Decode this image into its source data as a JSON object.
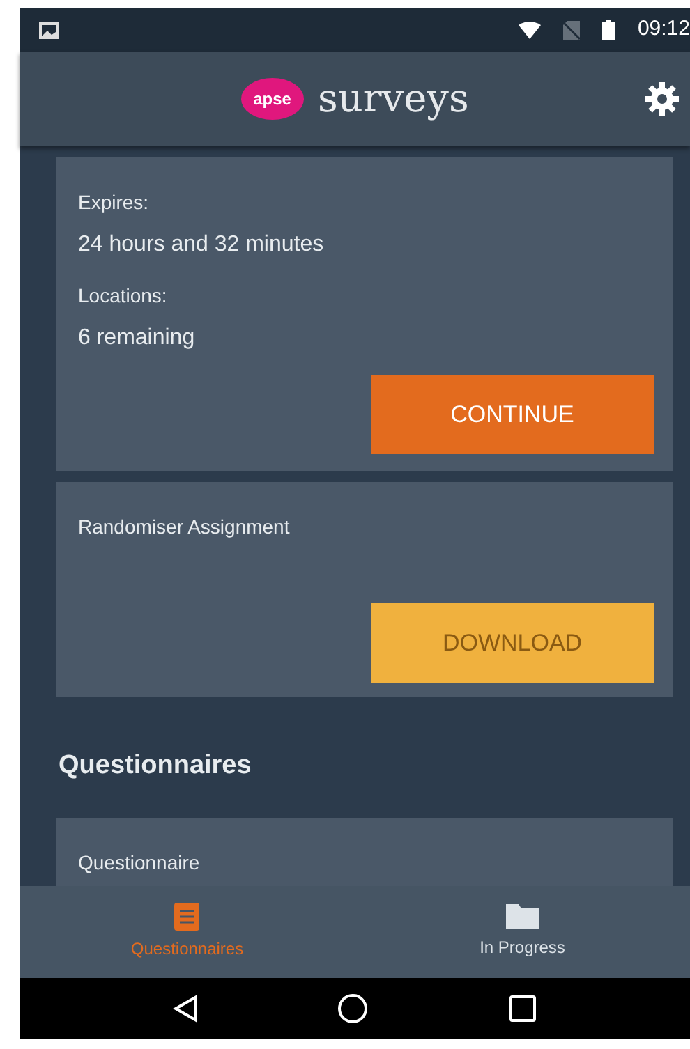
{
  "status_bar": {
    "time": "09:12"
  },
  "app_bar": {
    "logo_badge": "apse",
    "title": "surveys"
  },
  "assignment_card": {
    "fields": [
      {
        "label": "Expires:",
        "value": "24 hours and 32 minutes"
      },
      {
        "label": "Locations:",
        "value": "6 remaining"
      }
    ],
    "button": {
      "label": "CONTINUE",
      "disabled": false
    }
  },
  "randomiser_card": {
    "title": "Randomiser Assignment",
    "button": {
      "label": "DOWNLOAD",
      "disabled": true
    }
  },
  "section_heading": "Questionnaires",
  "questionnaire_card": {
    "title": "Questionnaire"
  },
  "bottom_tabs": [
    {
      "label": "Questionnaires",
      "kind": "list",
      "selected": true
    },
    {
      "label": "In Progress",
      "kind": "folder",
      "selected": false
    }
  ]
}
